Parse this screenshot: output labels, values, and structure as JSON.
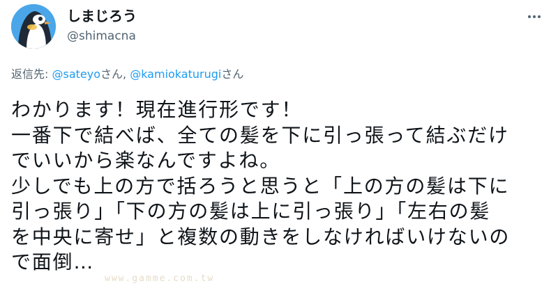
{
  "author": {
    "display_name": "しまじろう",
    "handle": "@shimacna",
    "avatar_icon": "penguin-icon"
  },
  "menu": {
    "icon": "more-horizontal-icon"
  },
  "reply": {
    "prefix": "返信先: ",
    "mention_1": "@sateyo",
    "suffix_1": "さん, ",
    "mention_2": "@kamiokaturugi",
    "suffix_2": "さん"
  },
  "tweet": {
    "lines": [
      "わかります！現在進行形です！",
      "一番下で結べば、全ての髪を下に引っ張って結ぶだけ",
      "でいいから楽なんですよね。",
      "少しでも上の方で括ろうと思うと「上の方の髪は下に",
      "引っ張り」「下の方の髪は上に引っ張り」「左右の髪",
      "を中央に寄せ」と複数の動きをしなければいけないの",
      "で面倒…"
    ]
  },
  "watermark": "www.gamme.com.tw",
  "colors": {
    "text": "#0f1419",
    "secondary": "#536471",
    "link": "#1d9bf0",
    "avatar_bg": "#4aa6e8"
  }
}
